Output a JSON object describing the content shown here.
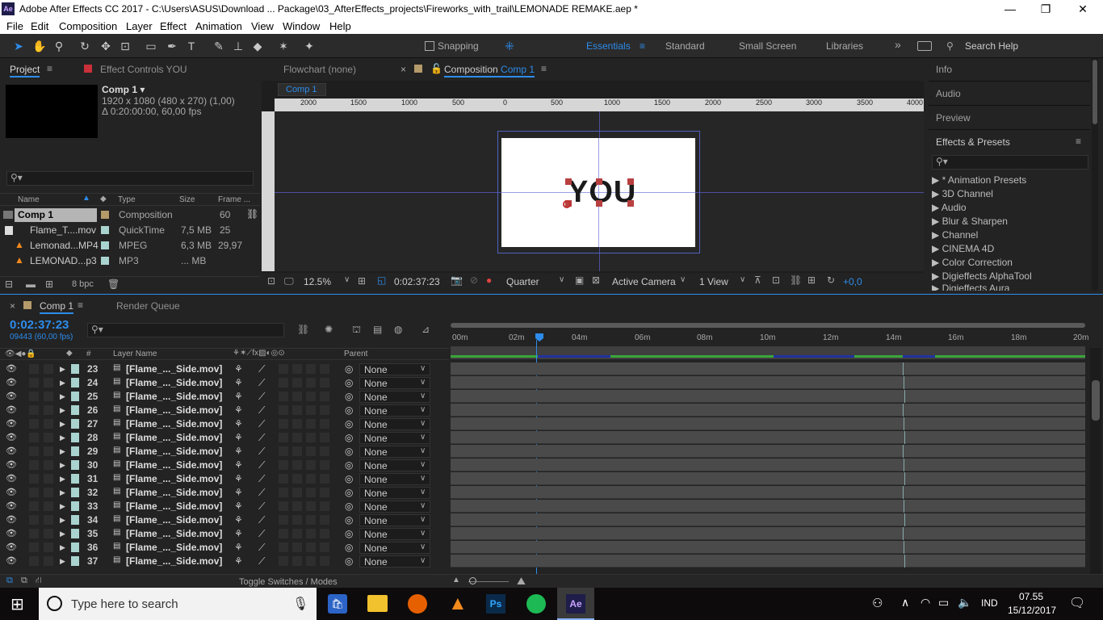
{
  "window": {
    "title": "Adobe After Effects CC 2017 - C:\\Users\\ASUS\\Download ... Package\\03_AfterEffects_projects\\Fireworks_with_trail\\LEMONADE REMAKE.aep *",
    "app_badge": "Ae"
  },
  "menu": [
    "File",
    "Edit",
    "Composition",
    "Layer",
    "Effect",
    "Animation",
    "View",
    "Window",
    "Help"
  ],
  "toolbar": {
    "snapping": "Snapping",
    "workspaces": [
      "Essentials",
      "Standard",
      "Small Screen",
      "Libraries"
    ],
    "search_placeholder": "Search Help"
  },
  "project": {
    "tab": "Project",
    "effect_tab": "Effect Controls YOU",
    "comp_name": "Comp 1 ▾",
    "comp_info1": "1920 x 1080  (480 x 270) (1,00)",
    "comp_info2": "Δ 0:20:00:00, 60,00 fps",
    "cols": [
      "Name",
      "Type",
      "Size",
      "Frame ..."
    ],
    "items": [
      {
        "name": "Comp 1",
        "type": "Composition",
        "size": "",
        "frame": "60"
      },
      {
        "name": "Flame_T....mov",
        "type": "QuickTime",
        "size": "7,5 MB",
        "frame": "25"
      },
      {
        "name": "Lemonad...MP4",
        "type": "MPEG",
        "size": "6,3 MB",
        "frame": "29,97"
      },
      {
        "name": "LEMONAD...p3",
        "type": "MP3",
        "size": "... MB",
        "frame": ""
      }
    ],
    "bpc": "8 bpc"
  },
  "viewer": {
    "flowchart": "Flowchart (none)",
    "comp_tab_prefix": "Composition",
    "comp_tab_name": "Comp 1",
    "crumb": "Comp 1",
    "ruler": [
      "2000",
      "1500",
      "1000",
      "500",
      "0",
      "500",
      "1000",
      "1500",
      "2000",
      "2500",
      "3000",
      "3500",
      "4000"
    ],
    "text": "YOU",
    "zoom": "12.5%",
    "timecode": "0:02:37:23",
    "resolution": "Quarter",
    "camera": "Active Camera",
    "views": "1 View",
    "exposure": "+0,0"
  },
  "right": {
    "info": "Info",
    "audio": "Audio",
    "preview": "Preview",
    "effects": "Effects & Presets",
    "effects_list": [
      "* Animation Presets",
      "3D Channel",
      "Audio",
      "Blur & Sharpen",
      "Channel",
      "CINEMA 4D",
      "Color Correction",
      "Digieffects AlphaTool",
      "Digieffects Aura"
    ]
  },
  "timeline": {
    "tab": "Comp 1",
    "render": "Render Queue",
    "timecode": "0:02:37:23",
    "frames": "09443 (60,00 fps)",
    "col_num": "#",
    "col_layer": "Layer Name",
    "col_parent": "Parent",
    "ticks": [
      "00m",
      "02m",
      "04m",
      "06m",
      "08m",
      "10m",
      "12m",
      "14m",
      "16m",
      "18m",
      "20m"
    ],
    "toggle": "Toggle Switches / Modes",
    "layers": [
      {
        "n": "23",
        "name": "[Flame_..._Side.mov]",
        "parent": "None"
      },
      {
        "n": "24",
        "name": "[Flame_..._Side.mov]",
        "parent": "None"
      },
      {
        "n": "25",
        "name": "[Flame_..._Side.mov]",
        "parent": "None"
      },
      {
        "n": "26",
        "name": "[Flame_..._Side.mov]",
        "parent": "None"
      },
      {
        "n": "27",
        "name": "[Flame_..._Side.mov]",
        "parent": "None"
      },
      {
        "n": "28",
        "name": "[Flame_..._Side.mov]",
        "parent": "None"
      },
      {
        "n": "29",
        "name": "[Flame_..._Side.mov]",
        "parent": "None"
      },
      {
        "n": "30",
        "name": "[Flame_..._Side.mov]",
        "parent": "None"
      },
      {
        "n": "31",
        "name": "[Flame_..._Side.mov]",
        "parent": "None"
      },
      {
        "n": "32",
        "name": "[Flame_..._Side.mov]",
        "parent": "None"
      },
      {
        "n": "33",
        "name": "[Flame_..._Side.mov]",
        "parent": "None"
      },
      {
        "n": "34",
        "name": "[Flame_..._Side.mov]",
        "parent": "None"
      },
      {
        "n": "35",
        "name": "[Flame_..._Side.mov]",
        "parent": "None"
      },
      {
        "n": "36",
        "name": "[Flame_..._Side.mov]",
        "parent": "None"
      },
      {
        "n": "37",
        "name": "[Flame_..._Side.mov]",
        "parent": "None"
      }
    ]
  },
  "taskbar": {
    "search": "Type here to search",
    "lang": "IND",
    "time": "07.55",
    "date": "15/12/2017"
  }
}
